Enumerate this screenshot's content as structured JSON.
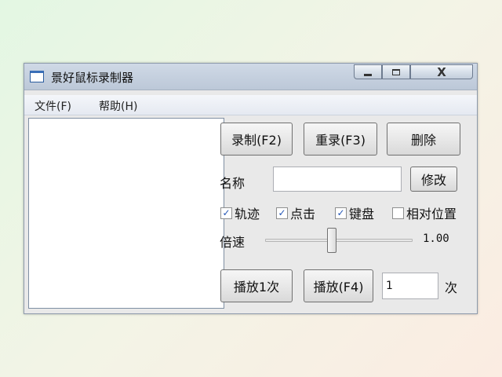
{
  "window": {
    "title": "景好鼠标录制器",
    "controls": {
      "close_glyph": "X"
    }
  },
  "menu": {
    "file": "文件(F)",
    "help": "帮助(H)"
  },
  "buttons": {
    "record": "录制(F2)",
    "rerecord": "重录(F3)",
    "delete": "删除",
    "rename": "修改",
    "play_once": "播放1次",
    "play": "播放(F4)"
  },
  "name_field": {
    "label": "名称",
    "value": ""
  },
  "options": [
    {
      "label": "轨迹",
      "checked": true
    },
    {
      "label": "点击",
      "checked": true
    },
    {
      "label": "键盘",
      "checked": true
    },
    {
      "label": "相对位置",
      "checked": false
    }
  ],
  "speed": {
    "label": "倍速",
    "value_text": "1.00"
  },
  "repeat": {
    "value": "1",
    "unit": "次"
  },
  "icons": {
    "check_glyph": "✓"
  }
}
